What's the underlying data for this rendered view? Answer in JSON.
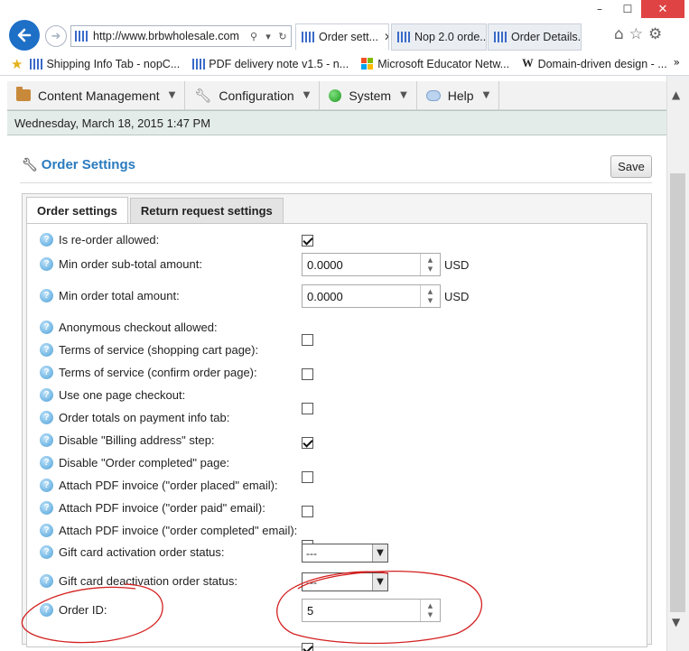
{
  "browser": {
    "window_controls": {
      "minimize": "–",
      "maximize": "☐",
      "close": "✕"
    },
    "address": "http://www.brbwholesale.com",
    "tabs": [
      {
        "label": "Order sett...",
        "active": true
      },
      {
        "label": "Nop 2.0 orde...",
        "active": false
      },
      {
        "label": "Order Details...",
        "active": false
      }
    ],
    "favorites": [
      {
        "label": "Shipping Info Tab - nopC..."
      },
      {
        "label": "PDF delivery note  v1.5 - n..."
      },
      {
        "label": "Microsoft Educator Netw..."
      },
      {
        "label": "Domain-driven design - ..."
      }
    ]
  },
  "menu": {
    "items": [
      {
        "label": "Content Management",
        "icon": "folder-icon"
      },
      {
        "label": "Configuration",
        "icon": "wrench-icon"
      },
      {
        "label": "System",
        "icon": "system-icon"
      },
      {
        "label": "Help",
        "icon": "help-icon"
      }
    ]
  },
  "datetime": "Wednesday, March 18, 2015 1:47 PM",
  "page": {
    "title": "Order Settings",
    "save_label": "Save",
    "tabs": [
      {
        "label": "Order settings",
        "active": true
      },
      {
        "label": "Return request settings",
        "active": false
      }
    ]
  },
  "settings": [
    {
      "label": "Is re-order allowed:",
      "type": "checkbox",
      "checked": true
    },
    {
      "label": "Min order sub-total amount:",
      "type": "number",
      "value": "0.0000",
      "unit": "USD"
    },
    {
      "label": "Min order total amount:",
      "type": "number",
      "value": "0.0000",
      "unit": "USD"
    },
    {
      "label": "Anonymous checkout allowed:",
      "type": "checkbox",
      "checked": false
    },
    {
      "label": "Terms of service (shopping cart page):",
      "type": "checkbox",
      "checked": false
    },
    {
      "label": "Terms of service (confirm order page):",
      "type": "checkbox",
      "checked": false
    },
    {
      "label": "Use one page checkout:",
      "type": "checkbox",
      "checked": true
    },
    {
      "label": "Order totals on payment info tab:",
      "type": "checkbox",
      "checked": false
    },
    {
      "label": "Disable \"Billing address\" step:",
      "type": "checkbox",
      "checked": false
    },
    {
      "label": "Disable \"Order completed\" page:",
      "type": "checkbox",
      "checked": false
    },
    {
      "label": "Attach PDF invoice (\"order placed\" email):",
      "type": "checkbox",
      "checked": false
    },
    {
      "label": "Attach PDF invoice (\"order paid\" email):",
      "type": "checkbox",
      "checked": false
    },
    {
      "label": "Attach PDF invoice (\"order completed\" email):",
      "type": "checkbox",
      "checked": true
    },
    {
      "label": "Gift card activation order status:",
      "type": "select",
      "value": "---"
    },
    {
      "label": "Gift card deactivation order status:",
      "type": "select",
      "value": "---"
    },
    {
      "label": "Order ID:",
      "type": "number",
      "value": "5",
      "unit": ""
    }
  ],
  "annotation_color": "#d42020"
}
